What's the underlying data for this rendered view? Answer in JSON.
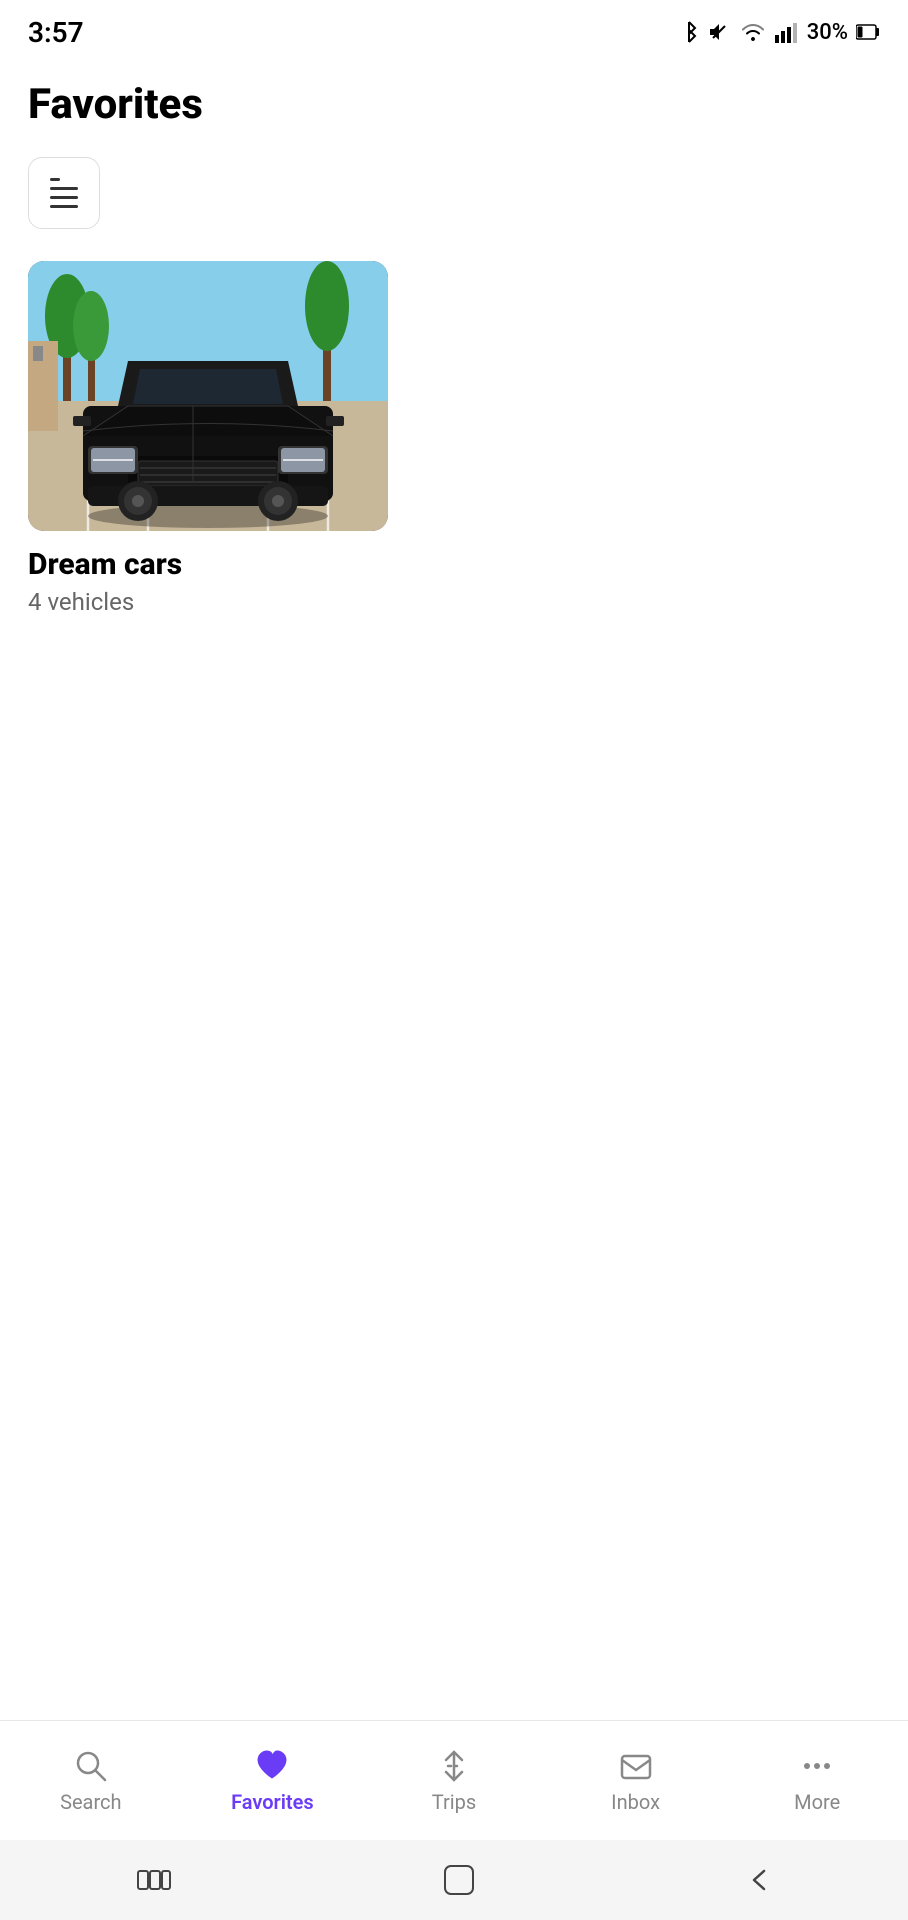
{
  "statusBar": {
    "time": "3:57",
    "battery": "30%",
    "icons": {
      "bluetooth": "⬡",
      "mute": "🔇",
      "wifi": "wifi",
      "signal": "signal",
      "battery": "battery"
    }
  },
  "page": {
    "title": "Favorites"
  },
  "viewToggle": {
    "ariaLabel": "Toggle list view"
  },
  "collection": {
    "name": "Dream cars",
    "vehicleCount": "4 vehicles"
  },
  "bottomNav": {
    "items": [
      {
        "id": "search",
        "label": "Search",
        "active": false
      },
      {
        "id": "favorites",
        "label": "Favorites",
        "active": true
      },
      {
        "id": "trips",
        "label": "Trips",
        "active": false
      },
      {
        "id": "inbox",
        "label": "Inbox",
        "active": false
      },
      {
        "id": "more",
        "label": "More",
        "active": false
      }
    ]
  },
  "colors": {
    "activeNav": "#6B3CF5",
    "inactiveNav": "#888888",
    "background": "#ffffff"
  }
}
